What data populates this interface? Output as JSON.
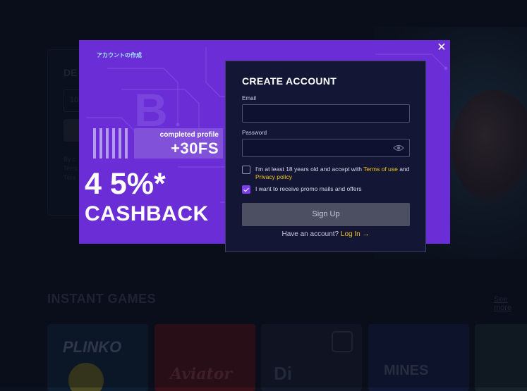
{
  "background": {
    "deposit": {
      "title": "DE",
      "input_value": "10",
      "line1": "By c",
      "line2": "Term",
      "line3": "Tera"
    },
    "section_title": "INSTANT GAMES",
    "see_more": "See more",
    "games": [
      {
        "title": "PLINKO"
      },
      {
        "title": "Aviator"
      },
      {
        "title": "Di"
      },
      {
        "title": "MINES"
      }
    ]
  },
  "modal": {
    "promo_tag": "アカウントの作成",
    "profile_small": "completed profile",
    "profile_big": "+30FS",
    "cashback_percent": "4 5%*",
    "cashback_word": "CASHBACK",
    "close_icon": "close-icon",
    "form": {
      "title": "CREATE ACCOUNT",
      "email_label": "Email",
      "email_value": "",
      "password_label": "Password",
      "password_value": "",
      "age_text": "I'm at least 18 years old and accept with",
      "terms_link": "Terms of use",
      "and": "and",
      "privacy_link": "Privacy policy",
      "age_checked": false,
      "promo_text": "I want to receive promo mails and offers",
      "promo_checked": true,
      "signup_label": "Sign Up",
      "have_account": "Have an account?",
      "login_link": "Log In →"
    }
  },
  "colors": {
    "modal_purple": "#6b2ed6",
    "panel_navy": "#131735",
    "link_yellow": "#f5c518",
    "checkbox_accent": "#7b3ef0"
  }
}
